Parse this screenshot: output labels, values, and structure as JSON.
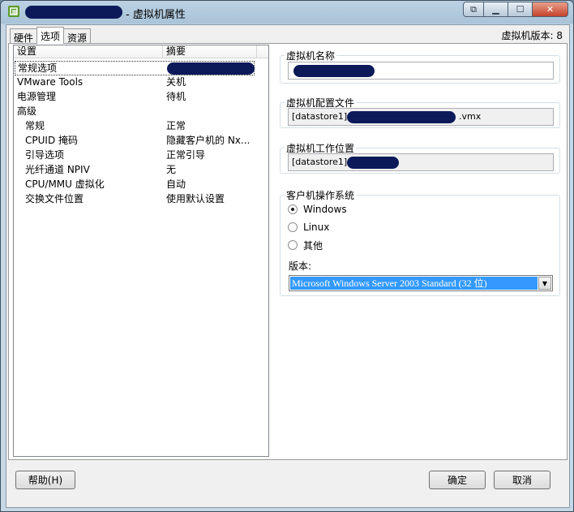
{
  "window": {
    "title": "- 虚拟机属性",
    "caption_buttons": [
      "restore-icon",
      "minimize-icon",
      "maximize-icon",
      "close-icon"
    ]
  },
  "tabs": [
    {
      "label": "硬件"
    },
    {
      "label": "选项",
      "active": true
    },
    {
      "label": "资源"
    }
  ],
  "vm_version": "虚拟机版本: 8",
  "settings_list": {
    "headers": [
      "设置",
      "摘要"
    ],
    "rows": [
      {
        "name": "常规选项",
        "summary": "",
        "selected": true,
        "indent": false
      },
      {
        "name": "VMware Tools",
        "summary": "关机",
        "indent": false
      },
      {
        "name": "电源管理",
        "summary": "待机",
        "indent": false
      },
      {
        "name": "高级",
        "summary": "",
        "indent": false
      },
      {
        "name": "常规",
        "summary": "正常",
        "indent": true
      },
      {
        "name": "CPUID 掩码",
        "summary": "隐藏客户机的 Nx...",
        "indent": true
      },
      {
        "name": "引导选项",
        "summary": "正常引导",
        "indent": true
      },
      {
        "name": "光纤通道 NPIV",
        "summary": "无",
        "indent": true
      },
      {
        "name": "CPU/MMU 虚拟化",
        "summary": "自动",
        "indent": true
      },
      {
        "name": "交换文件位置",
        "summary": "使用默认设置",
        "indent": true
      }
    ]
  },
  "vm_name": {
    "legend": "虚拟机名称",
    "value": ""
  },
  "vm_config_file": {
    "legend": "虚拟机配置文件",
    "prefix": "[datastore1]",
    "suffix": ".vmx"
  },
  "vm_work_location": {
    "legend": "虚拟机工作位置",
    "prefix": "[datastore1]"
  },
  "guest_os": {
    "legend": "客户机操作系统",
    "options": [
      {
        "label": "Windows",
        "checked": true
      },
      {
        "label": "Linux",
        "checked": false
      },
      {
        "label": "其他",
        "checked": false
      }
    ],
    "version_label": "版本:",
    "version_value": "Microsoft Windows Server 2003 Standard (32 位)"
  },
  "buttons": {
    "help": "帮助(H)",
    "ok": "确定",
    "cancel": "取消"
  },
  "colors": {
    "redaction": "#0c1a5a",
    "selection": "#3399ff"
  }
}
